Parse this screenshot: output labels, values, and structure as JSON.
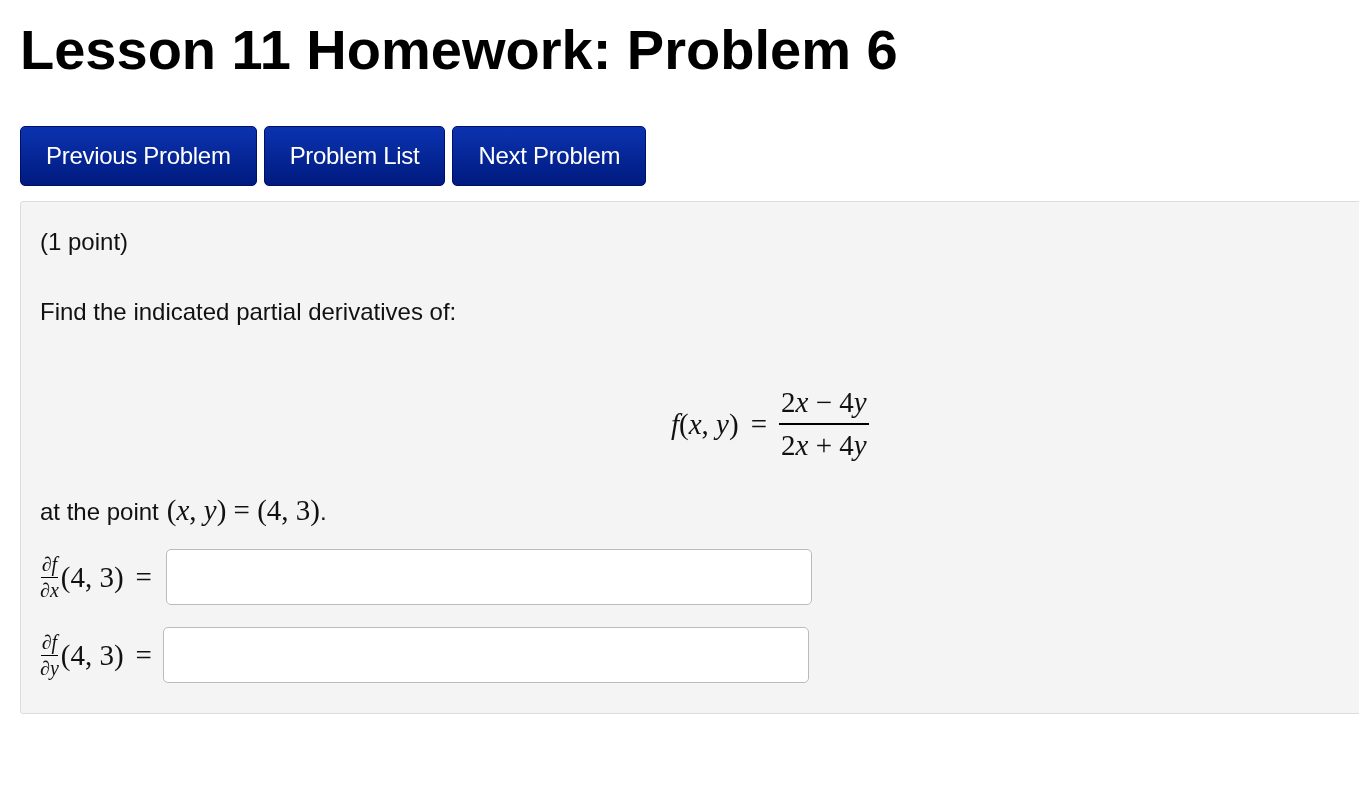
{
  "title": "Lesson 11 Homework: Problem 6",
  "nav_buttons": [
    {
      "label": "Previous Problem"
    },
    {
      "label": "Problem List"
    },
    {
      "label": "Next Problem"
    }
  ],
  "problem": {
    "points": "(1 point)",
    "instruction": "Find the indicated partial derivatives of:",
    "formula": {
      "lhs": "*f*(*x*, *y*)",
      "eq": "=",
      "numerator": [
        "2",
        "*x* − 4",
        "*y*"
      ],
      "denominator": [
        "2",
        "*x* + 4",
        "*y*"
      ]
    },
    "point_text": "at the point",
    "point_math": "(*x*, *y*) = (4, 3)",
    "point_end": ".",
    "answers": [
      {
        "numerator": "∂*f*",
        "denominator": "∂*x*",
        "argument": "(4, 3)",
        "eq": "="
      },
      {
        "numerator": "∂*f*",
        "denominator": "∂*y*",
        "argument": "(4, 3)",
        "eq": "="
      }
    ]
  }
}
